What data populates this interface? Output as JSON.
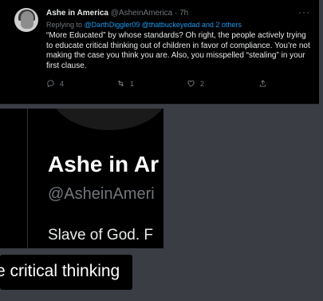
{
  "tweet": {
    "name": "Ashe in America",
    "handle": "@AsheinAmerica",
    "time": "· 7h",
    "more_label": "···",
    "reply_prefix": "Replying to",
    "reply_targets": "@DarthDiggler09 @thatbuckeyedad and 2 others",
    "body": "“More Educated” by whose standards? Oh right, the people actively trying to educate critical thinking out of children in favor of compliance. You’re not making the case you think you are. Also, you misspelled “stealing” in your first clause.",
    "actions": {
      "reply_count": "4",
      "retweet_count": "1",
      "like_count": "2"
    },
    "icons": [
      "reply-icon",
      "retweet-icon",
      "like-icon",
      "share-icon"
    ]
  },
  "profile": {
    "name": "Ashe in Ar",
    "handle": "@AsheinAmeri",
    "bio": "Slave of God. F"
  },
  "caption": {
    "text": "e critical thinking"
  },
  "colors": {
    "background": "#3a3d44",
    "card": "#000000",
    "link": "#1d9bf0",
    "muted": "#71767b"
  }
}
